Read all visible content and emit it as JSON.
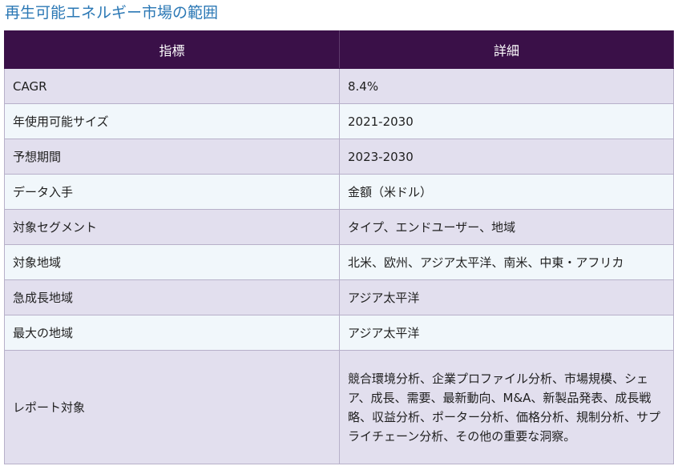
{
  "title": "再生可能エネルギー市場の範囲",
  "table": {
    "headers": [
      "指標",
      "詳細"
    ],
    "rows": [
      {
        "metric": "CAGR",
        "detail": "8.4%"
      },
      {
        "metric": "年使用可能サイズ",
        "detail": "2021-2030"
      },
      {
        "metric": "予想期間",
        "detail": "2023-2030"
      },
      {
        "metric": "データ入手",
        "detail": "金額（米ドル）"
      },
      {
        "metric": "対象セグメント",
        "detail": "タイプ、エンドユーザー、地域"
      },
      {
        "metric": "対象地域",
        "detail": "北米、欧州、アジア太平洋、南米、中東・アフリカ"
      },
      {
        "metric": "急成長地域",
        "detail": "アジア太平洋"
      },
      {
        "metric": "最大の地域",
        "detail": "アジア太平洋"
      },
      {
        "metric": "レポート対象",
        "detail": "競合環境分析、企業プロファイル分析、市場規模、シェア、成長、需要、最新動向、M&A、新製品発表、成長戦略、収益分析、ポーター分析、価格分析、規制分析、サプライチェーン分析、その他の重要な洞察。"
      }
    ]
  }
}
